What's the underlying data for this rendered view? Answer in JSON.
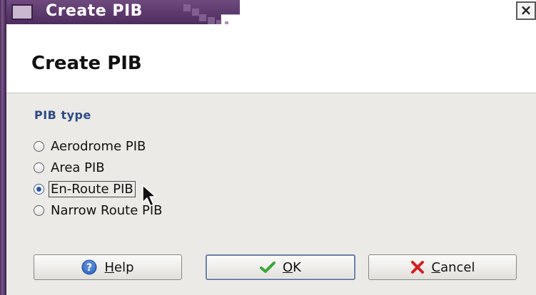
{
  "window": {
    "title": "Create PIB",
    "close_glyph": "×"
  },
  "header": {
    "title": "Create PIB"
  },
  "pib_type": {
    "label": "PIB type",
    "options": [
      {
        "label": "Aerodrome PIB",
        "selected": false
      },
      {
        "label": "Area PIB",
        "selected": false
      },
      {
        "label": "En-Route PIB",
        "selected": true
      },
      {
        "label": "Narrow Route PIB",
        "selected": false
      }
    ]
  },
  "buttons": {
    "help": {
      "mnemonic": "H",
      "rest": "elp",
      "icon": "help-icon"
    },
    "ok": {
      "mnemonic": "O",
      "rest": "K",
      "icon": "checkmark-icon"
    },
    "cancel": {
      "mnemonic": "C",
      "rest": "ancel",
      "icon": "cancel-x-icon"
    }
  },
  "colors": {
    "titlebar": "#5e3a6e",
    "section_title": "#2c4a86",
    "radio_selected": "#2e56a8",
    "ok_check": "#3aa63a",
    "cancel_x": "#d42020",
    "help_icon": "#3a6ec8"
  }
}
